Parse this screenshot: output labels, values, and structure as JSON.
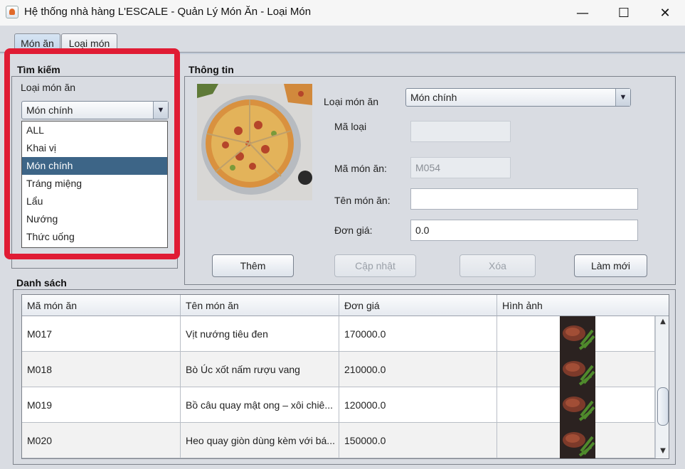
{
  "window": {
    "title": "Hệ thống nhà hàng L'ESCALE - Quản Lý Món Ăn - Loại Món",
    "minimize": "—",
    "maximize": "☐",
    "close": "✕"
  },
  "tabs": [
    {
      "label": "Món ăn",
      "active": true
    },
    {
      "label": "Loại món",
      "active": false
    }
  ],
  "search": {
    "title": "Tìm kiếm",
    "category_label": "Loại món ăn",
    "category_value": "Món chính",
    "options": [
      "ALL",
      "Khai vị",
      "Món chính",
      "Tráng miệng",
      "Lẩu",
      "Nướng",
      "Thức uống"
    ],
    "selected_index": 2
  },
  "info": {
    "title": "Thông tin",
    "category_label": "Loại món ăn",
    "category_value": "Món chính",
    "code_type_label": "Mã loại",
    "code_type_value": "",
    "dish_code_label": "Mã món ăn:",
    "dish_code_value": "M054",
    "dish_name_label": "Tên món ăn:",
    "dish_name_value": "",
    "price_label": "Đơn giá:",
    "price_value": "0.0"
  },
  "buttons": {
    "add": "Thêm",
    "update": "Cập nhật",
    "delete": "Xóa",
    "refresh": "Làm mới"
  },
  "list": {
    "title": "Danh sách",
    "columns": [
      "Mã món ăn",
      "Tên món ăn",
      "Đơn giá",
      "Hình ảnh"
    ],
    "rows": [
      {
        "code": "M017",
        "name": "Vịt nướng tiêu đen",
        "price": "170000.0"
      },
      {
        "code": "M018",
        "name": "Bò Úc xốt nấm rượu vang",
        "price": "210000.0"
      },
      {
        "code": "M019",
        "name": "Bồ câu quay mật ong – xôi chiê...",
        "price": "120000.0"
      },
      {
        "code": "M020",
        "name": "Heo quay giòn dùng kèm với bá...",
        "price": "150000.0"
      }
    ]
  },
  "colors": {
    "highlight_frame": "#e01c34",
    "selected_item": "#3d6587"
  }
}
